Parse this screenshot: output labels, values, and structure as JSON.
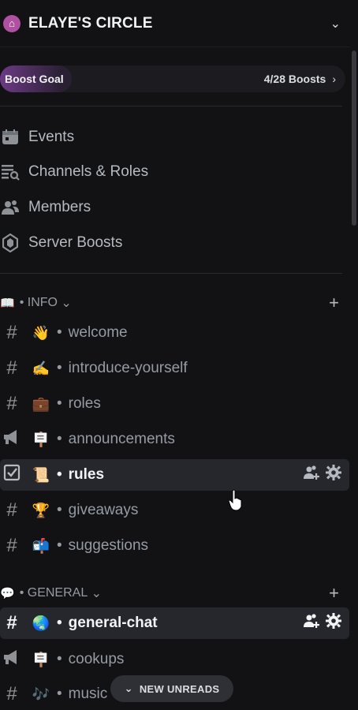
{
  "header": {
    "title": "ELAYE'S CIRCLE",
    "icon": "house-icon"
  },
  "boost": {
    "label": "Boost Goal",
    "count": "4/28 Boosts"
  },
  "menu": [
    {
      "label": "Events",
      "icon": "calendar-icon"
    },
    {
      "label": "Channels & Roles",
      "icon": "channels-roles-icon"
    },
    {
      "label": "Members",
      "icon": "members-icon"
    },
    {
      "label": "Server Boosts",
      "icon": "boost-gem-icon"
    }
  ],
  "categories": [
    {
      "emoji": "📖",
      "name": "INFO"
    },
    {
      "emoji": "💬",
      "name": "GENERAL"
    }
  ],
  "channels": [
    {
      "emoji": "👋",
      "name": "welcome",
      "type": "text"
    },
    {
      "emoji": "✍️",
      "name": "introduce-yourself",
      "type": "text"
    },
    {
      "emoji": "💼",
      "name": "roles",
      "type": "text"
    },
    {
      "emoji": "🪧",
      "name": "announcements",
      "type": "announcement"
    },
    {
      "emoji": "📜",
      "name": "rules",
      "type": "rules",
      "state": "hovered"
    },
    {
      "emoji": "🏆",
      "name": "giveaways",
      "type": "text"
    },
    {
      "emoji": "📬",
      "name": "suggestions",
      "type": "text"
    },
    {
      "emoji": "🌏",
      "name": "general-chat",
      "type": "text",
      "state": "selected"
    },
    {
      "emoji": "🪧",
      "name": "cookups",
      "type": "announcement"
    },
    {
      "emoji": "🎶",
      "name": "music",
      "type": "text"
    }
  ],
  "separator": "•",
  "new_unreads": "NEW UNREADS"
}
